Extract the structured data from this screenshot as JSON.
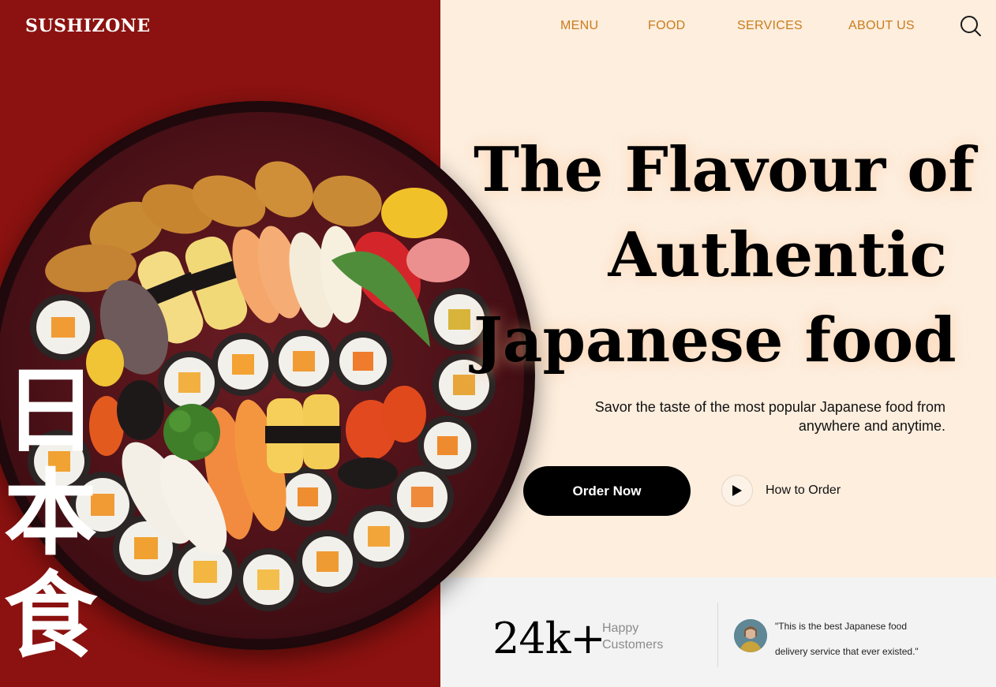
{
  "brand": {
    "logo_text": "SUSHIZONE"
  },
  "nav": {
    "items": [
      "MENU",
      "FOOD",
      "SERVICES",
      "ABOUT US"
    ],
    "search_icon": "search-icon"
  },
  "hero": {
    "headline_lines": [
      "The Flavour of",
      "Authentic",
      "Japanese food"
    ],
    "subtext_lines": [
      "Savor the taste of the most popular Japanese food from",
      "anywhere and anytime."
    ],
    "primary_button": "Order Now",
    "secondary_button": "How to Order",
    "kanji": [
      "日",
      "本",
      "食"
    ]
  },
  "stats": {
    "number": "24k+",
    "label_lines": [
      "Happy",
      "Customers"
    ],
    "testimonial_lines": [
      "\"This is the best Japanese food",
      "delivery service that ever existed.\""
    ]
  },
  "colors": {
    "left_panel": "#8b1210",
    "right_panel": "#fdeede",
    "stats_panel": "#f3f3f3",
    "nav_link": "#c97c1c",
    "button": "#000000"
  }
}
